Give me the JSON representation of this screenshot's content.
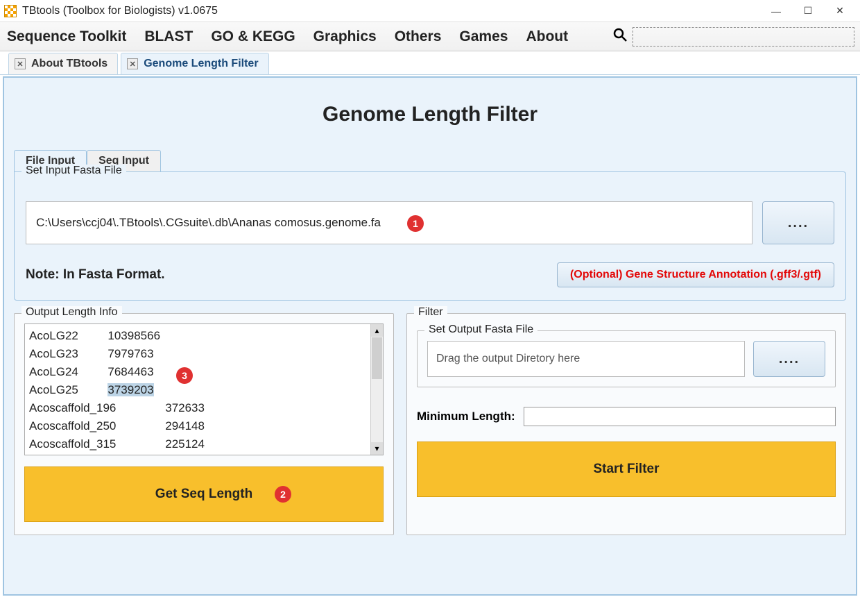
{
  "window": {
    "title": "TBtools (Toolbox for Biologists) v1.0675"
  },
  "menu": {
    "items": [
      "Sequence Toolkit",
      "BLAST",
      "GO & KEGG",
      "Graphics",
      "Others",
      "Games",
      "About"
    ]
  },
  "doc_tabs": {
    "items": [
      {
        "label": "About TBtools",
        "active": false
      },
      {
        "label": "Genome Length Filter",
        "active": true
      }
    ]
  },
  "page": {
    "title": "Genome Length Filter"
  },
  "inner_tabs": {
    "items": [
      {
        "label": "File Input",
        "active": true
      },
      {
        "label": "Seq Input",
        "active": false
      }
    ]
  },
  "input_section": {
    "legend": "Set Input Fasta File",
    "path": "C:\\Users\\ccj04\\.TBtools\\.CGsuite\\.db\\Ananas comosus.genome.fa",
    "browse_label": "....",
    "note": "Note: In Fasta Format.",
    "optional_btn": "(Optional) Gene Structure Annotation (.gff3/.gtf)"
  },
  "output_panel": {
    "legend": "Output Length Info",
    "rows": [
      {
        "name": "AcoLG22",
        "len": "10398566",
        "pad": 1
      },
      {
        "name": "AcoLG23",
        "len": "7979763",
        "pad": 1
      },
      {
        "name": "AcoLG24",
        "len": "7684463",
        "pad": 1
      },
      {
        "name": "AcoLG25",
        "len": "3739203",
        "pad": 1,
        "hl": true
      },
      {
        "name": "Acoscaffold_196",
        "len": "372633",
        "pad": 2
      },
      {
        "name": "Acoscaffold_250",
        "len": "294148",
        "pad": 2
      },
      {
        "name": "Acoscaffold_315",
        "len": "225124",
        "pad": 2
      }
    ],
    "button": "Get Seq Length"
  },
  "filter_panel": {
    "legend": "Filter",
    "sub_legend": "Set Output Fasta File",
    "output_placeholder": "Drag the output Diretory here",
    "browse_label": "....",
    "minlen_label": "Minimum Length:",
    "start_btn": "Start Filter"
  },
  "badges": {
    "b1": "1",
    "b2": "2",
    "b3": "3"
  }
}
